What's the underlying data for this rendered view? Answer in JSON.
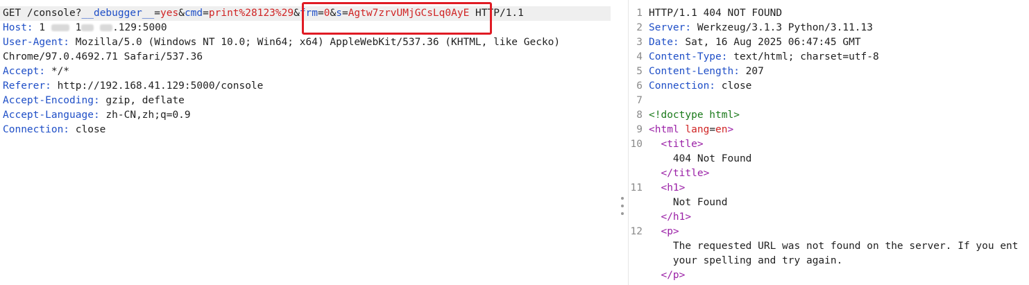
{
  "request": {
    "line1": {
      "method": "GET ",
      "path": "/console?",
      "p1_key": "__debugger__",
      "eq1": "=",
      "p1_val": "yes",
      "amp1": "&",
      "p2_key": "cmd",
      "eq2": "=",
      "p2_val": "print%28123%29",
      "amp2": "&",
      "p3_key": "frm",
      "eq3": "=",
      "p3_val": "0",
      "amp3": "&",
      "p4_key": "s",
      "eq4": "=",
      "p4_val": "Agtw7zrvUMjGCsLq0AyE",
      "proto": " HTTP/1.1"
    },
    "headers": {
      "host_key": "Host:",
      "host_val_pre": " 1",
      "host_val_mid": " 1",
      "host_val_post": ".129:5000",
      "ua_key": "User-Agent:",
      "ua_val": " Mozilla/5.0 (Windows NT 10.0; Win64; x64) AppleWebKit/537.36 (KHTML, like Gecko)",
      "ua_cont": "Chrome/97.0.4692.71 Safari/537.36",
      "accept_key": "Accept:",
      "accept_val": " */*",
      "referer_key": "Referer:",
      "referer_val": " http://192.168.41.129:5000/console",
      "enc_key": "Accept-Encoding:",
      "enc_val": " gzip, deflate",
      "lang_key": "Accept-Language:",
      "lang_val": " zh-CN,zh;q=0.9",
      "conn_key": "Connection:",
      "conn_val": " close"
    }
  },
  "response": {
    "line_numbers": [
      "1",
      "2",
      "3",
      "4",
      "5",
      "6",
      "7",
      "8",
      "9",
      "10",
      "11",
      "12"
    ],
    "status": "HTTP/1.1 404 NOT FOUND",
    "server_key": "Server:",
    "server_val": " Werkzeug/3.1.3 Python/3.11.13",
    "date_key": "Date:",
    "date_val": " Sat, 16 Aug 2025 06:47:45 GMT",
    "ctype_key": "Content-Type:",
    "ctype_val": " text/html; charset=utf-8",
    "clen_key": "Content-Length:",
    "clen_val": " 207",
    "conn_key": "Connection:",
    "conn_val": " close",
    "doctype": "<!doctype html>",
    "html_open_a": "<html ",
    "html_attr": "lang",
    "html_eq": "=",
    "html_lang": "en",
    "html_open_b": ">",
    "title_open": "  <title>",
    "title_text": "    404 Not Found",
    "title_close": "  </title>",
    "h1_open": "  <h1>",
    "h1_text": "    Not Found",
    "h1_close": "  </h1>",
    "p_open": "  <p>",
    "p_text1": "    The requested URL was not found on the server. If you ent",
    "p_text2": "    your spelling and try again.",
    "p_close": "  </p>"
  },
  "colors": {
    "key": "#1f4fc7",
    "value": "#d02424",
    "tag": "#9a1fa6",
    "doctype": "#1b7a1b",
    "highlight_box": "#e01b24"
  },
  "icons": [
    "splitter-handle-icon"
  ]
}
